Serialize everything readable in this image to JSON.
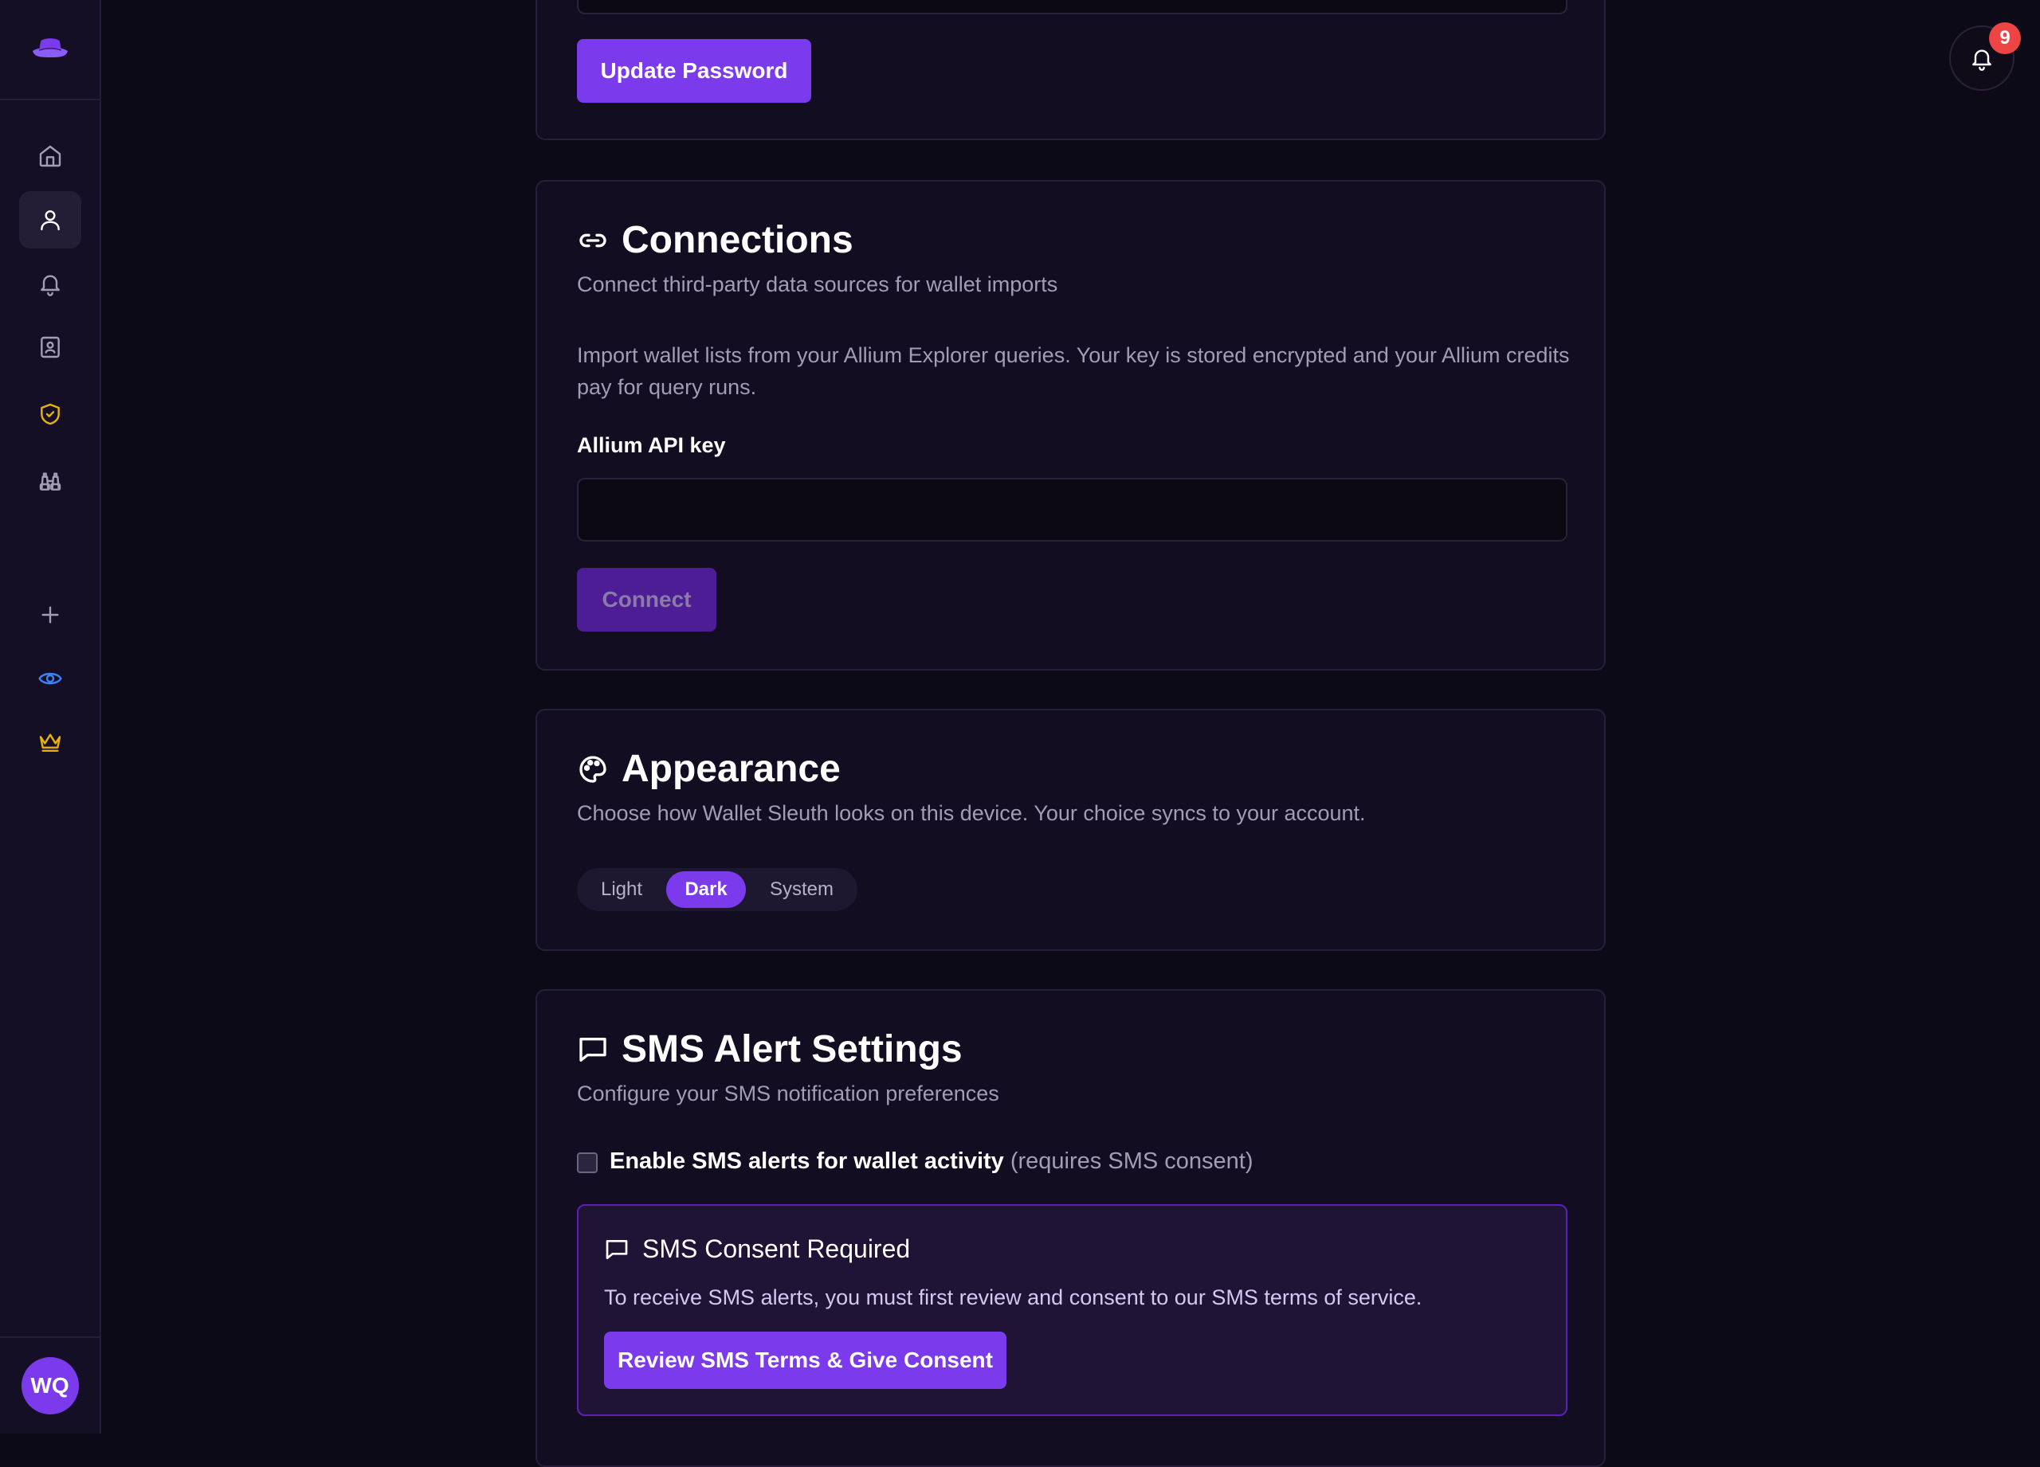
{
  "notifications": {
    "count": "9"
  },
  "user": {
    "initials": "WQ"
  },
  "password_section": {
    "button_label": "Update Password"
  },
  "connections": {
    "title": "Connections",
    "subtitle": "Connect third-party data sources for wallet imports",
    "description": "Import wallet lists from your Allium Explorer queries. Your key is stored encrypted and your Allium credits pay for query runs.",
    "field_label": "Allium API key",
    "field_value": "",
    "button_label": "Connect"
  },
  "appearance": {
    "title": "Appearance",
    "subtitle": "Choose how Wallet Sleuth looks on this device. Your choice syncs to your account.",
    "options": [
      "Light",
      "Dark",
      "System"
    ],
    "selected": "Dark"
  },
  "sms": {
    "title": "SMS Alert Settings",
    "subtitle": "Configure your SMS notification preferences",
    "checkbox_label": "Enable SMS alerts for wallet activity",
    "checkbox_note": "(requires SMS consent)",
    "checkbox_checked": false,
    "consent": {
      "title": "SMS Consent Required",
      "text": "To receive SMS alerts, you must first review and consent to our SMS terms of service.",
      "button_label": "Review SMS Terms & Give Consent"
    }
  },
  "colors": {
    "accent": "#7c3aed",
    "background": "#0d0a17",
    "card": "#120d20",
    "badge": "#ef4444",
    "shield": "#eab308",
    "eye": "#3b82f6",
    "crown": "#eab308"
  },
  "sidebar": {
    "items": [
      {
        "icon": "home-icon"
      },
      {
        "icon": "user-icon",
        "active": true
      },
      {
        "icon": "bell-icon"
      },
      {
        "icon": "contact-book-icon"
      },
      {
        "icon": "shield-check-icon"
      },
      {
        "icon": "binoculars-icon"
      },
      {
        "icon": "plus-icon"
      },
      {
        "icon": "eye-icon"
      },
      {
        "icon": "crown-icon"
      }
    ]
  }
}
